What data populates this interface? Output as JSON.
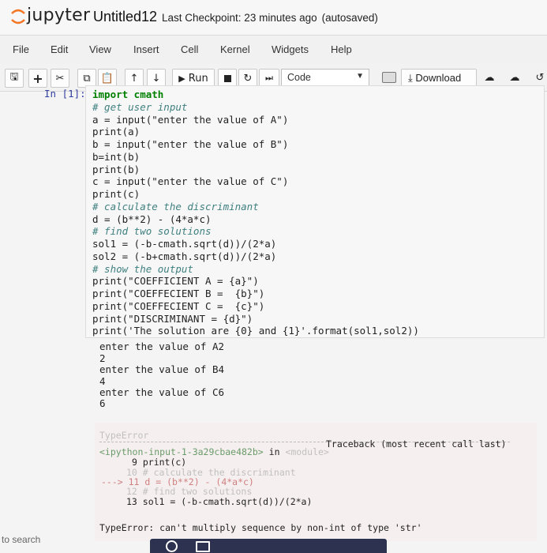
{
  "header": {
    "brand": "jupyter",
    "notebook_name": "Untitled12",
    "checkpoint": "Last Checkpoint: 23 minutes ago",
    "autosave": "(autosaved)"
  },
  "menu": {
    "items": [
      "File",
      "Edit",
      "View",
      "Insert",
      "Cell",
      "Kernel",
      "Widgets",
      "Help"
    ]
  },
  "toolbar": {
    "run_label": "Run",
    "cell_type": "Code",
    "download_label": "Download"
  },
  "cell": {
    "prompt": "In [1]:",
    "lines": [
      "import cmath",
      "# get user input",
      "a = input(\"enter the value of A\")",
      "print(a)",
      "b = input(\"enter the value of B\")",
      "b=int(b)",
      "print(b)",
      "c = input(\"enter the value of C\")",
      "print(c)",
      "# calculate the discriminant",
      "d = (b**2) - (4*a*c)",
      "# find two solutions",
      "sol1 = (-b-cmath.sqrt(d))/(2*a)",
      "sol2 = (-b+cmath.sqrt(d))/(2*a)",
      "# show the output",
      "print(\"COEFFICIENT A = {a}\")",
      "print(\"COEFFECIENT B =  {b}\")",
      "print(\"COEFFECIENT C =  {c}\")",
      "print(\"DISCRIMINANT = {d}\")",
      "print('The solution are {0} and {1}'.format(sol1,sol2))"
    ]
  },
  "output": {
    "lines": [
      "enter the value of A2",
      "2",
      "enter the value of B4",
      "4",
      "enter the value of C6",
      "6"
    ]
  },
  "error": {
    "type": "TypeError",
    "traceback_label": "Traceback (most recent call last)",
    "file": "<ipython-input-1-3a29cbae482b>",
    "in_label": "in",
    "module": "<module>",
    "frames": [
      "9 print(c)",
      "10 # calculate the discriminant",
      "---> 11 d = (b**2) - (4*a*c)",
      "12 # find two solutions",
      "13 sol1 = (-b-cmath.sqrt(d))/(2*a)"
    ],
    "message": "TypeError: can't multiply sequence by non-int of type 'str'"
  },
  "taskbar": {
    "search": "to search"
  }
}
